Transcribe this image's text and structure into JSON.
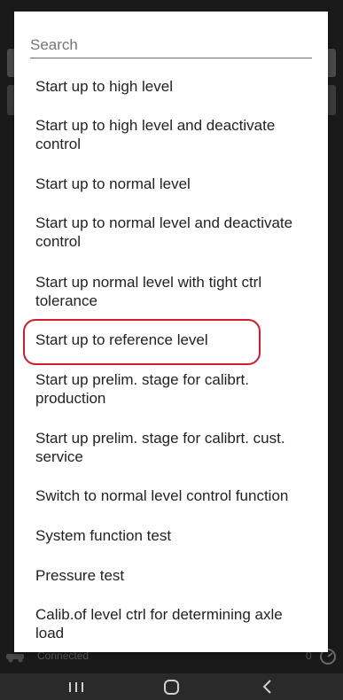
{
  "search": {
    "placeholder": "Search"
  },
  "items": [
    "Start up to high level",
    "Start up to high level and deactivate control",
    "Start up to normal level",
    "Start up to normal level and deactivate control",
    "Start up normal level with tight ctrl tolerance",
    "Start up to reference level",
    "Start up prelim. stage for calibrt. production",
    "Start up prelim. stage for calibrt. cust. service",
    "Switch to normal level control function",
    "System function test",
    "Pressure test",
    "Calib.of level ctrl for determining axle load"
  ],
  "highlighted_item": "Start up to reference level",
  "status_bar": {
    "connection": "Connected",
    "count": "0"
  },
  "colors": {
    "highlight": "#d11d2a",
    "dialog_bg": "#ffffff",
    "backdrop": "#1a1a1a"
  },
  "nav": {
    "recent": "recent-apps-icon",
    "home": "home-icon",
    "back": "back-icon"
  }
}
